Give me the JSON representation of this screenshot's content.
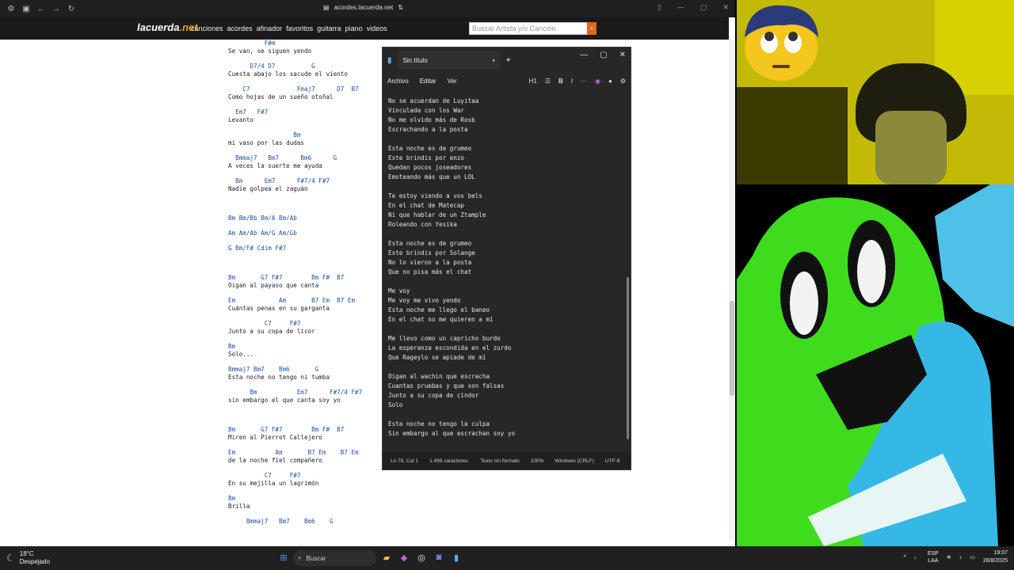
{
  "browser": {
    "url": "acordes.lacuerda.net",
    "site": {
      "logo": "lacuerda",
      "logo_tld": ".net",
      "nav": [
        "canciones",
        "acordes",
        "afinador",
        "favoritos",
        "guitarra",
        "piano",
        "videos"
      ],
      "search_placeholder": "Buscar Artista y/o Canción"
    }
  },
  "song": [
    {
      "c": "          F#m",
      "l": "Se van, se siguen yendo"
    },
    {
      "c": "      D7/4 D7          G",
      "l": "Cuesta abajo los sacude el viento"
    },
    {
      "c": "    C7             Fmaj7      D7  B7",
      "l": "Como hojas de un sueño otoñal"
    },
    {
      "c": "  Em7   F#7",
      "l": "Levanto"
    },
    {
      "c": "                  Bm",
      "l": "mi vaso por las dudas"
    },
    {
      "c": "  Bmmaj7   Bm7      Bm6      G",
      "l": "A veces la suerte me ayuda"
    },
    {
      "c": "  Bm      Em7      F#7/4 F#7",
      "l": "Nadie golpea el zaguán"
    },
    {
      "c": "",
      "l": ""
    },
    {
      "c": "Bm Bm/Bb Bm/A Bm/Ab",
      "l": ""
    },
    {
      "c": "Am Am/Ab Am/G Am/Gb",
      "l": ""
    },
    {
      "c": "G Bm/F# Cdim F#7",
      "l": ""
    },
    {
      "c": "",
      "l": ""
    },
    {
      "c": "Bm       G7 F#7        Bm F#  B7",
      "l": "Oigan al payaso que canta"
    },
    {
      "c": "Em            Am       B7 Em  B7 Em",
      "l": "Cuántas penas en su garganta"
    },
    {
      "c": "          C7     F#7",
      "l": "Junto a su copa de licor"
    },
    {
      "c": "Bm",
      "l": "Solo..."
    },
    {
      "c": "Bmmaj7 Bm7    Bm6       G",
      "l": "Esta noche no tengo ni tumba"
    },
    {
      "c": "      Bm           Em7      F#7/4 F#7",
      "l": "sin embargo el que canta soy yo"
    },
    {
      "c": "",
      "l": ""
    },
    {
      "c": "Bm       G7 F#7        Bm F#  B7",
      "l": "Miren al Pierrot Callejero"
    },
    {
      "c": "Em           Am       B7 Em    B7 Em",
      "l": "de la noche fiel compañero"
    },
    {
      "c": "          C7     F#7",
      "l": "En su mejilla un lagrimón"
    },
    {
      "c": "Bm",
      "l": "Brilla"
    },
    {
      "c": "     Bmmaj7   Bm7    Bm6    G",
      "l": ""
    }
  ],
  "notepad": {
    "tab_title": "Sin título",
    "menu": [
      "Archivo",
      "Editar",
      "Ver"
    ],
    "heading": "H1",
    "lines": [
      "No se acuerdan de Luyitaa",
      "Vinculada con los War",
      "No me olvido más de Rosb",
      "Escrachando a la posta",
      "",
      "Esta noche es de grumeo",
      "Este brindis por enzo",
      "Quedan pocos joseadores",
      "Emoteando más que un LOL",
      "",
      "Te estoy viendo a vos bels",
      "En el chat de Matecap",
      "Ni que hablar de un Ztample",
      "Roleando con Yesika",
      "",
      "Esta noche es de grumeo",
      "Este brindis por Solange",
      "No lo vieron a la posta",
      "Que no pisa más el chat",
      "",
      "Me voy",
      "Me voy me vivo yendo",
      "Esta noche me llego el baneo",
      "En el chat no me quieren a mí",
      "",
      "Me llevo como un capricho burdo",
      "La esperanza escondida en el zurdo",
      "Que Rageylo se apiade de mí",
      "",
      "Oigan al wachin que escracha",
      "Cuantas pruebas y que son falsas",
      "Junto a su copa de cindor",
      "Solo",
      "",
      "Esta noche no tengo la culpa",
      "Sin embargo al que escrachan soy yo"
    ],
    "status": [
      "Ln 78, Col 1",
      "1.499 caracteres.",
      "Texto sin formato",
      "100%",
      "Windows (CRLF)",
      "UTF-8"
    ]
  },
  "taskbar": {
    "temp": "18°C",
    "weather": "Despejado",
    "search": "Buscar",
    "lang1": "ESP",
    "lang2": "LAA",
    "time": "19:07",
    "date": "28/8/2025"
  }
}
